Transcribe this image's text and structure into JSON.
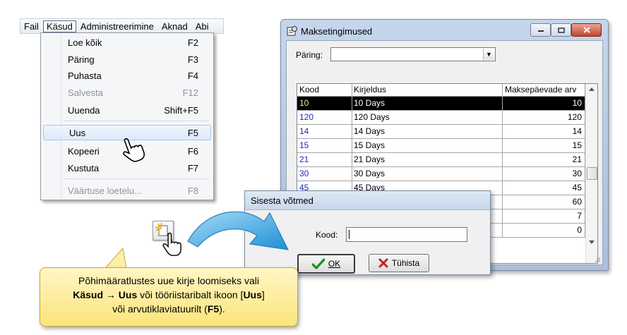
{
  "menubar": {
    "items": [
      "Fail",
      "Käsud",
      "Administreerimine",
      "Aknad",
      "Abi"
    ],
    "active_index": 1
  },
  "dropdown": {
    "items": [
      {
        "label": "Loe kõik",
        "shortcut": "F2",
        "disabled": false
      },
      {
        "label": "Päring",
        "shortcut": "F3",
        "disabled": false
      },
      {
        "label": "Puhasta",
        "shortcut": "F4",
        "disabled": false
      },
      {
        "label": "Salvesta",
        "shortcut": "F12",
        "disabled": true
      },
      {
        "label": "Uuenda",
        "shortcut": "Shift+F5",
        "disabled": false
      },
      {
        "label": "Uus",
        "shortcut": "F5",
        "disabled": false,
        "hovered": true
      },
      {
        "label": "Kopeeri",
        "shortcut": "F6",
        "disabled": false
      },
      {
        "label": "Kustuta",
        "shortcut": "F7",
        "disabled": false
      },
      {
        "label": "Väärtuse loetelu...",
        "shortcut": "F8",
        "disabled": true
      }
    ]
  },
  "window": {
    "title": "Maksetingimused",
    "paring_label": "Päring:",
    "paring_value": "",
    "columns": [
      "Kood",
      "Kirjeldus",
      "Maksepäevade arv"
    ],
    "rows": [
      {
        "kood": "10",
        "kirjeldus": "10 Days",
        "arv": "10",
        "selected": true
      },
      {
        "kood": "120",
        "kirjeldus": "120 Days",
        "arv": "120"
      },
      {
        "kood": "14",
        "kirjeldus": "14 Days",
        "arv": "14"
      },
      {
        "kood": "15",
        "kirjeldus": "15 Days",
        "arv": "15"
      },
      {
        "kood": "21",
        "kirjeldus": "21 Days",
        "arv": "21"
      },
      {
        "kood": "30",
        "kirjeldus": "30 Days",
        "arv": "30"
      },
      {
        "kood": "45",
        "kirjeldus": "45 Days",
        "arv": "45"
      },
      {
        "kood": "",
        "kirjeldus": "",
        "arv": "60"
      },
      {
        "kood": "",
        "kirjeldus": "",
        "arv": "7"
      },
      {
        "kood": "",
        "kirjeldus": "",
        "arv": "0"
      }
    ]
  },
  "dialog": {
    "title": "Sisesta võtmed",
    "kood_label": "Kood:",
    "kood_value": "",
    "ok_label": "OK",
    "cancel_label": "Tühista"
  },
  "callout": {
    "line1": "Põhimääratlustes uue kirje loomiseks vali",
    "line2_bold1": "Käsud",
    "line2_arrow": " → ",
    "line2_bold2": "Uus",
    "line2_rest": " või tööriistaribalt ikoon [",
    "line2_bold3": "Uus",
    "line2_end": "]",
    "line3_pre": "või arvutiklaviatuurilt (",
    "line3_bold": "F5",
    "line3_end": ")."
  },
  "colors": {
    "callout_bg": "#fbe57b",
    "arrow": "#3aa6e0",
    "selected_row_bg": "#000000",
    "kood_text": "#1c2cb4"
  },
  "icons": [
    "hand-pointer-icon",
    "new-record-icon",
    "window-app-icon",
    "minimize-icon",
    "maximize-icon",
    "close-icon",
    "combo-arrow-icon",
    "ok-check-icon",
    "cancel-x-icon",
    "blue-curved-arrow-icon"
  ]
}
